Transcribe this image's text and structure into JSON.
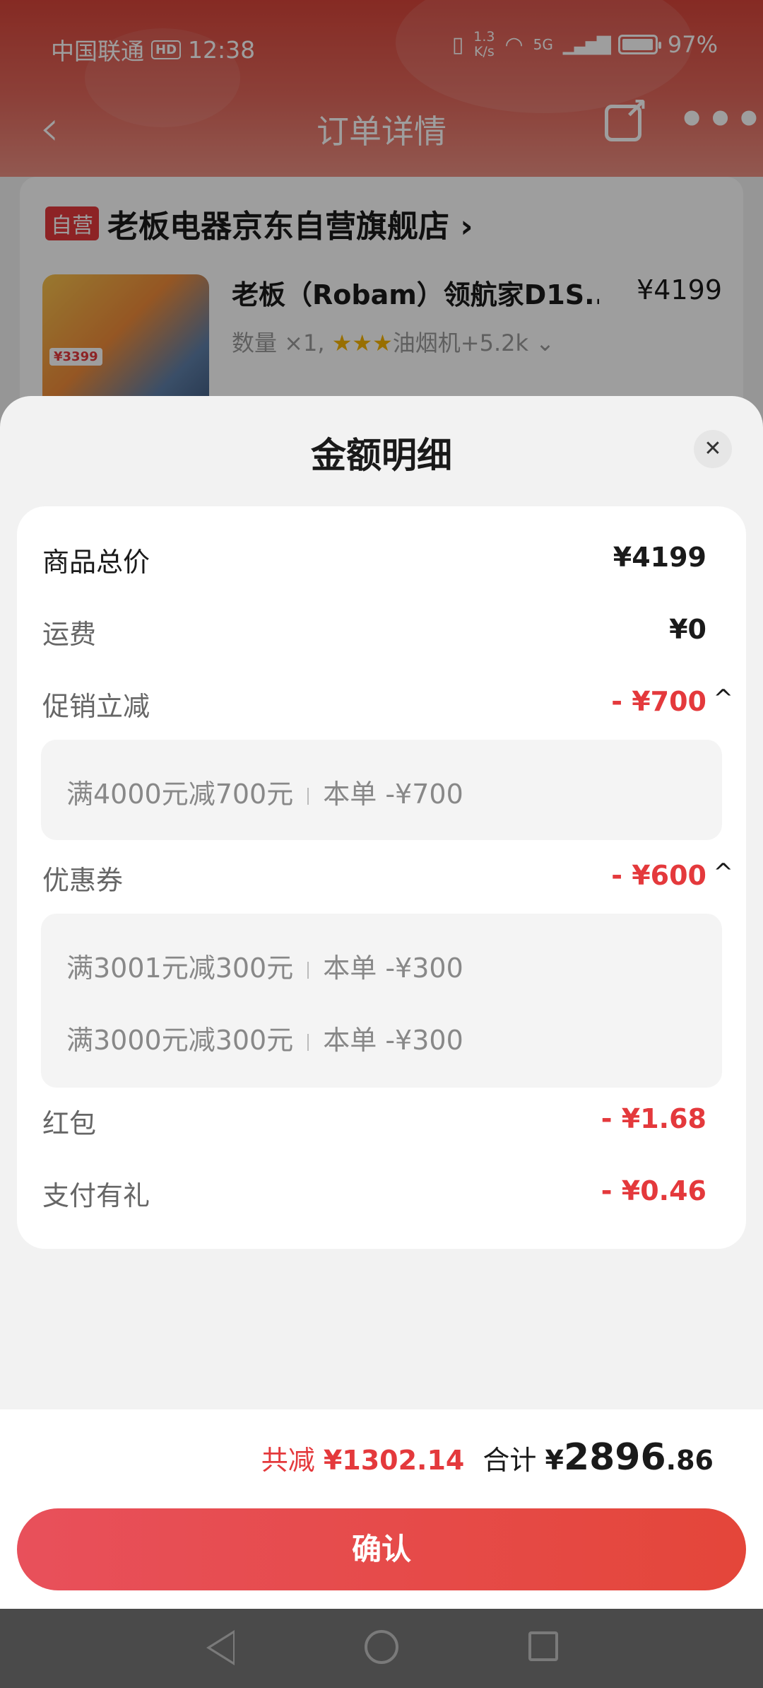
{
  "status_bar": {
    "carrier": "中国联通",
    "hd": "HD",
    "time": "12:38",
    "speed_top": "1.3",
    "speed_bottom": "K/s",
    "signal": "5G",
    "battery": "97%"
  },
  "nav": {
    "back_icon": "chevron-left-icon",
    "title": "订单详情",
    "share_icon": "share-icon",
    "more_icon": "more-icon"
  },
  "store": {
    "badge": "自营",
    "name": "老板电器京东自营旗舰店",
    "name_arrow": "›",
    "product_name": "老板（Robam）领航家D1S...",
    "product_price": "¥4199",
    "product_meta_prefix": "数量 ×1, ",
    "product_stars": "★★★",
    "product_meta_suffix": "油烟机+5.2k ⌄",
    "product_img_tag": "¥3399"
  },
  "sheet": {
    "title": "金额明细",
    "close_icon": "close-icon",
    "rows": {
      "goods_total": {
        "label": "商品总价",
        "value": "¥4199"
      },
      "shipping": {
        "label": "运费",
        "value": "¥0"
      },
      "promo": {
        "label": "促销立减",
        "value": "- ¥700",
        "chevron": "^"
      },
      "promo_items": [
        {
          "rule": "满4000元减700元",
          "amount": "本单 -¥700"
        }
      ],
      "coupon": {
        "label": "优惠券",
        "value": "- ¥600",
        "chevron": "^"
      },
      "coupon_items": [
        {
          "rule": "满3001元减300元",
          "amount": "本单 -¥300"
        },
        {
          "rule": "满3000元减300元",
          "amount": "本单 -¥300"
        }
      ],
      "red_packet": {
        "label": "红包",
        "value": "- ¥1.68"
      },
      "pay_gift": {
        "label": "支付有礼",
        "value": "- ¥0.46"
      }
    }
  },
  "footer": {
    "reduce_label": "共减",
    "reduce_value": "¥1302.14",
    "total_label": "合计",
    "total_currency": "¥",
    "total_integer": "2896",
    "total_decimal": ".86",
    "confirm": "确认"
  },
  "colors": {
    "accent_red": "#e4393c",
    "header_red": "#d8453a"
  }
}
